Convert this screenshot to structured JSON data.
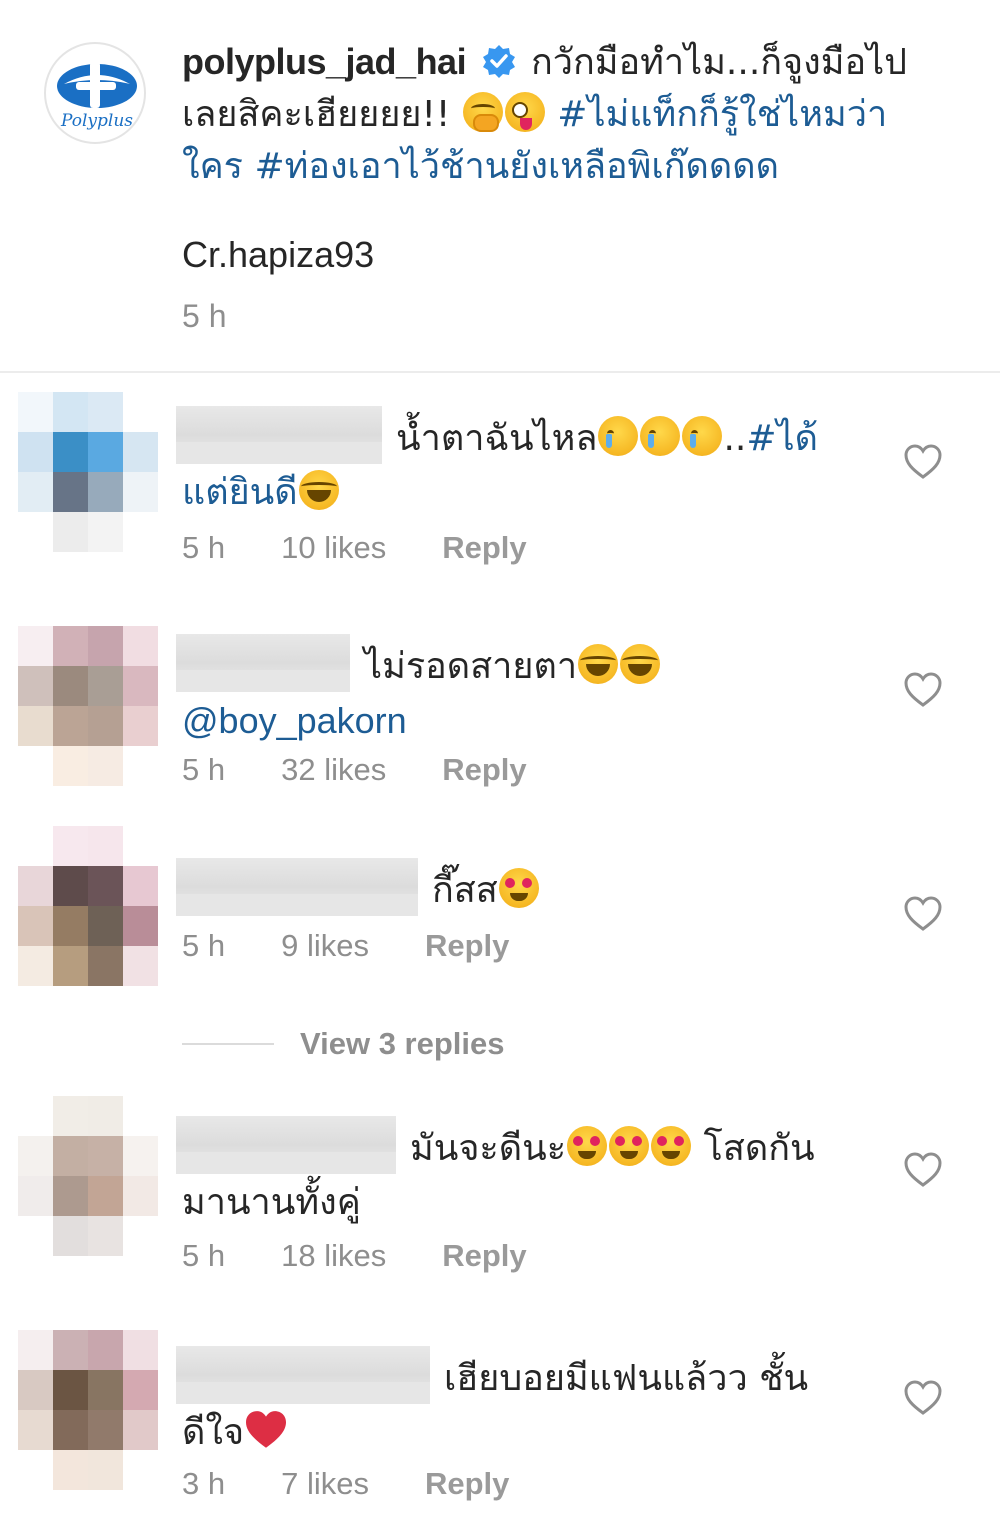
{
  "post": {
    "username": "polyplus_jad_hai",
    "logo_text": "Polyplus",
    "caption_text": "กวักมือทำไม...ก็จูงมือไปเลยสิคะเฮียยยย!!",
    "hashtag_1": "#ไม่แท็กก็รู้ใช่ไหมว่าใคร",
    "hashtag_2": "#ท่องเอาไว้ช้านยังเหลือพิเก๊ดดดด",
    "credit": "Cr.hapiza93",
    "time": "5 h",
    "emojis": [
      "face-with-hand-over-mouth-icon",
      "zany-face-icon"
    ]
  },
  "comments": [
    {
      "text": "น้ำตาฉันไหล",
      "text_after": "..",
      "hashtag": "#ได้",
      "line2": "แต่ยินดี",
      "time": "5 h",
      "likes": "10 likes",
      "reply": "Reply",
      "emojis": [
        "crying-face-icon",
        "crying-face-icon",
        "crying-face-icon",
        "tears-of-joy-icon"
      ]
    },
    {
      "text": "ไม่รอดสายตา",
      "mention": "@boy_pakorn",
      "time": "5 h",
      "likes": "32 likes",
      "reply": "Reply",
      "emojis": [
        "tears-of-joy-icon",
        "tears-of-joy-icon"
      ]
    },
    {
      "text": "กี๊สส",
      "time": "5 h",
      "likes": "9 likes",
      "reply": "Reply",
      "emojis": [
        "heart-eyes-icon"
      ],
      "view_replies": "View 3 replies"
    },
    {
      "text": "มันจะดีนะ",
      "text_after": "โสดกัน",
      "line2": "มานานทั้งคู่",
      "time": "5 h",
      "likes": "18 likes",
      "reply": "Reply",
      "emojis": [
        "heart-eyes-icon",
        "heart-eyes-icon",
        "heart-eyes-icon"
      ]
    },
    {
      "text": "เฮียบอยมีแฟนแล้วว ชั้น",
      "line2": "ดีใจ",
      "time": "3 h",
      "likes": "7 likes",
      "reply": "Reply",
      "emojis": [
        "red-heart-icon"
      ]
    }
  ],
  "colors": {
    "hashtag": "#1d5c94",
    "meta": "#8e8e8e",
    "verified": "#3897f0",
    "logo_blue": "#1a6fc4"
  }
}
